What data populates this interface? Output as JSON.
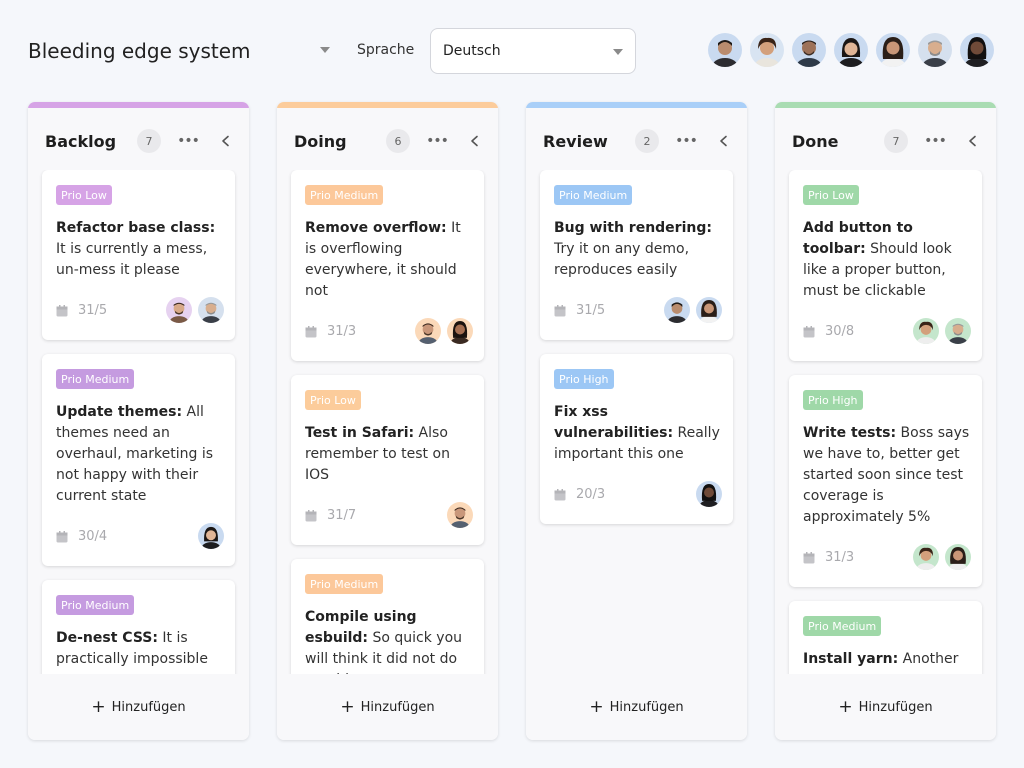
{
  "header": {
    "board_title": "Bleeding edge system",
    "language_label": "Sprache",
    "language_value": "Deutsch"
  },
  "colors": {
    "backlog": "#d6a3e6",
    "doing": "#fccc9b",
    "review": "#a9cff8",
    "done": "#a9dcb2",
    "prio_low_purple": "#d6a3e6",
    "prio_medium_purple": "#c59be0",
    "prio_medium_orange": "#fcc89a",
    "prio_low_orange": "#fccc9b",
    "prio_medium_blue": "#9cc7f5",
    "prio_high_blue": "#9cc7f5",
    "prio_low_green": "#9fd8a8",
    "prio_high_green": "#9fd8a8",
    "prio_medium_green": "#9fd8a8"
  },
  "columns": [
    {
      "title": "Backlog",
      "count": "7",
      "add_label": "Hinzufügen",
      "cards": [
        {
          "tag": "Prio Low",
          "title": "Refactor base class:",
          "body": " It is currently a mess, un-mess it please",
          "date": "31/5"
        },
        {
          "tag": "Prio Medium",
          "title": "Update themes:",
          "body": " All themes need an overhaul, marketing is not happy with their current state",
          "date": "30/4"
        },
        {
          "tag": "Prio Medium",
          "title": "De-nest CSS:",
          "body": " It is practically impossible",
          "date": ""
        }
      ]
    },
    {
      "title": "Doing",
      "count": "6",
      "add_label": "Hinzufügen",
      "cards": [
        {
          "tag": "Prio Medium",
          "title": "Remove overflow:",
          "body": " It is overflowing everywhere, it should not",
          "date": "31/3"
        },
        {
          "tag": "Prio Low",
          "title": "Test in Safari:",
          "body": " Also remember to test on IOS",
          "date": "31/7"
        },
        {
          "tag": "Prio Medium",
          "title": "Compile using esbuild:",
          "body": " So quick you will think it did not do anything...",
          "date": ""
        }
      ]
    },
    {
      "title": "Review",
      "count": "2",
      "add_label": "Hinzufügen",
      "cards": [
        {
          "tag": "Prio Medium",
          "title": "Bug with rendering:",
          "body": " Try it on any demo, reproduces easily",
          "date": "31/5"
        },
        {
          "tag": "Prio High",
          "title": "Fix xss vulnerabilities:",
          "body": " Really important this one",
          "date": "20/3"
        }
      ]
    },
    {
      "title": "Done",
      "count": "7",
      "add_label": "Hinzufügen",
      "cards": [
        {
          "tag": "Prio Low",
          "title": "Add button to toolbar:",
          "body": " Should look like a proper button, must be clickable",
          "date": "30/8"
        },
        {
          "tag": "Prio High",
          "title": "Write tests:",
          "body": " Boss says we have to, better get started soon since test coverage is approximately 5%",
          "date": "31/3"
        },
        {
          "tag": "Prio Medium",
          "title": "Install yarn:",
          "body": " Another",
          "date": ""
        }
      ]
    }
  ]
}
